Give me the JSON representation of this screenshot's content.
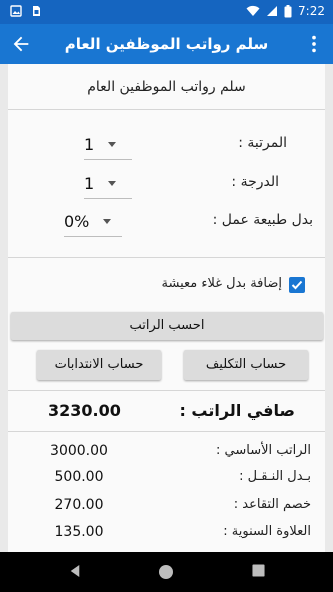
{
  "status_bar": {
    "time": "7:22",
    "icons": [
      "gallery-icon",
      "sim-card-icon",
      "wifi-icon",
      "signal-icon",
      "battery-icon"
    ]
  },
  "app_bar": {
    "title": "سلم رواتب الموظفين العام",
    "back_icon": "arrow-back-icon",
    "menu_icon": "more-vert-icon",
    "color": "#1976d2"
  },
  "form": {
    "header": "سلم رواتب الموظفين العام",
    "grade": {
      "label": "المرتبة :",
      "value": "1"
    },
    "degree": {
      "label": "الدرجة :",
      "value": "1"
    },
    "work_allowance": {
      "label": "بدل طبيعة عمل :",
      "value": "0%"
    },
    "cost_of_living": {
      "label": "إضافة بدل غلاء معيشة",
      "checked": true
    }
  },
  "buttons": {
    "calculate": "احسب الراتب",
    "assignment": "حساب التكليف",
    "secondment": "حساب الانتدابات"
  },
  "results": {
    "net_label": "صافي الراتب :",
    "net_value": "3230.00",
    "items": [
      {
        "label": "الراتب الأساسي :",
        "value": "3000.00"
      },
      {
        "label": "بـدل النـقـل :",
        "value": "500.00"
      },
      {
        "label": "خصم التقاعد :",
        "value": "270.00"
      },
      {
        "label": "العلاوة السنوية :",
        "value": "135.00"
      }
    ]
  },
  "nav_bar": {
    "icons": [
      "back-triangle-icon",
      "home-circle-icon",
      "recents-square-icon"
    ]
  }
}
